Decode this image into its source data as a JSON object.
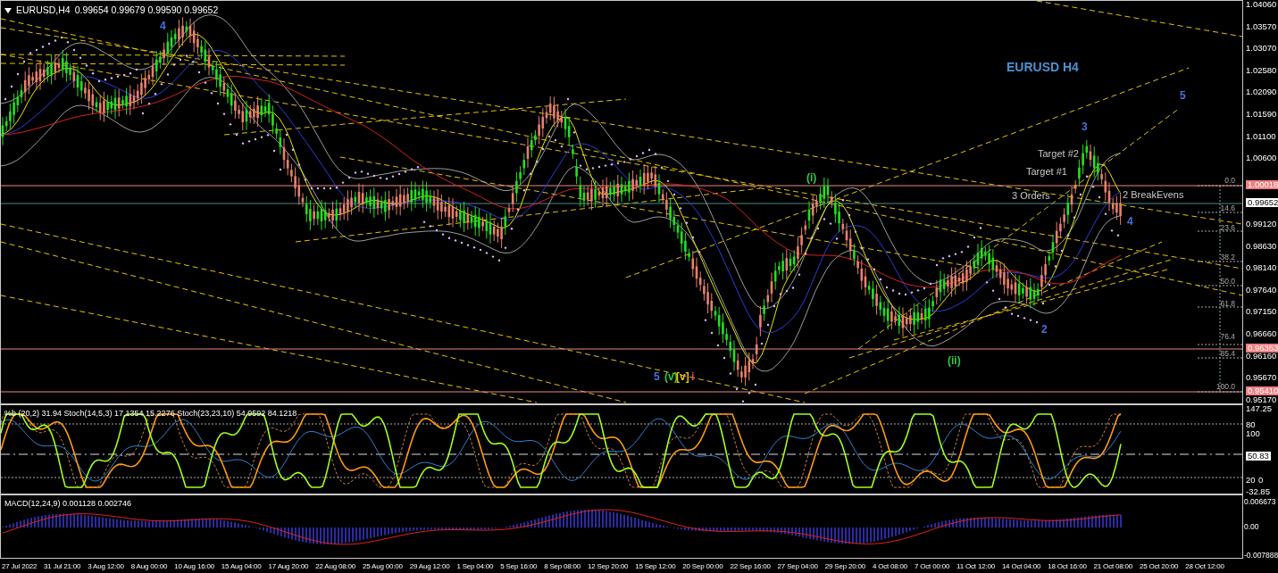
{
  "main_chart": {
    "symbol": "EURUSD,H4",
    "quote": "0.99654 0.99679 0.99590 0.99652",
    "title": "EURUSD H4",
    "price_axis": [
      "1.04060",
      "1.03570",
      "1.03070",
      "1.02580",
      "1.02090",
      "1.01590",
      "1.01100",
      "1.00600",
      "0.99120",
      "0.98630",
      "0.98140",
      "0.97640",
      "0.97150",
      "0.96660",
      "0.96160",
      "0.95670",
      "0.95170"
    ],
    "price_markers": [
      {
        "kind": "level",
        "text": "1.00018"
      },
      {
        "kind": "current",
        "text": "0.99652"
      },
      {
        "kind": "level",
        "text": "0.96353"
      },
      {
        "kind": "level",
        "text": "0.95410"
      }
    ],
    "fib_levels": [
      "0.0",
      "14.6",
      "23.6",
      "38.2",
      "50.0",
      "61.8",
      "76.4",
      "85.4",
      "100.0"
    ],
    "wave_labels": [
      {
        "text": "4",
        "color": "#4a6fe0"
      },
      {
        "text": "(i)",
        "color": "#2ecc40"
      },
      {
        "text": "(ii)",
        "color": "#2ecc40"
      },
      {
        "text": "5",
        "color": "#4a6fe0"
      },
      {
        "text": "(v)",
        "color": "#2ecc40"
      },
      {
        "text": "[v]",
        "color": "#e8c000"
      },
      {
        "text": "i",
        "color": "#e05050"
      },
      {
        "text": "2",
        "color": "#4a6fe0"
      },
      {
        "text": "3",
        "color": "#4a6fe0"
      },
      {
        "text": "4",
        "color": "#4a6fe0"
      },
      {
        "text": "5",
        "color": "#4a6fe0"
      }
    ],
    "trade_labels": [
      "Target #2",
      "Target #1",
      "3 Orders",
      "2 BreakEvens"
    ]
  },
  "stoch_panel": {
    "header": "%b (20,2) 31.94  Stoch(14,5,3) 17.1354 15.2276  Stoch(23,23,10) 54.9592 84.1218",
    "axis": [
      "147.25",
      "80",
      "100",
      "50.83",
      "20",
      "0",
      "-32.85"
    ]
  },
  "macd_panel": {
    "header": "MACD(12,24,9) 0.001128 0.002746",
    "axis": [
      "0.006673",
      "0.00",
      "-0.007888"
    ]
  },
  "time_axis": [
    "27 Jul 2022",
    "31 Jul 21:00",
    "3 Aug 12:00",
    "8 Aug 00:00",
    "10 Aug 16:00",
    "15 Aug 04:00",
    "17 Aug 20:00",
    "22 Aug 08:00",
    "25 Aug 00:00",
    "29 Aug 12:00",
    "1 Sep 04:00",
    "5 Sep 16:00",
    "8 Sep 08:00",
    "12 Sep 20:00",
    "15 Sep 12:00",
    "20 Sep 00:00",
    "22 Sep 16:00",
    "27 Sep 04:00",
    "29 Sep 20:00",
    "4 Oct 08:00",
    "7 Oct 00:00",
    "11 Oct 12:00",
    "14 Oct 04:00",
    "18 Oct 16:00",
    "21 Oct 08:00",
    "25 Oct 20:00",
    "28 Oct 12:00"
  ]
}
